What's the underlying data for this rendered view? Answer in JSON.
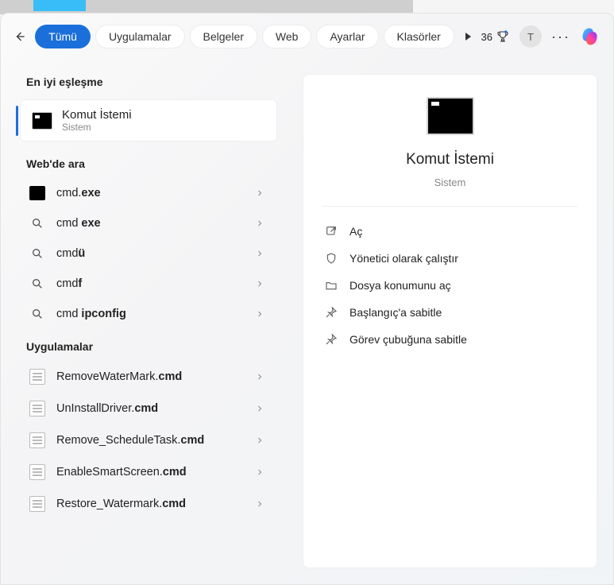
{
  "header": {
    "tabs": [
      {
        "id": "all",
        "label": "Tümü",
        "active": true
      },
      {
        "id": "apps",
        "label": "Uygulamalar",
        "active": false
      },
      {
        "id": "docs",
        "label": "Belgeler",
        "active": false
      },
      {
        "id": "web",
        "label": "Web",
        "active": false
      },
      {
        "id": "settings",
        "label": "Ayarlar",
        "active": false
      },
      {
        "id": "folders",
        "label": "Klasörler",
        "active": false
      }
    ],
    "points_value": "36",
    "avatar_initial": "T"
  },
  "left": {
    "section_best_match": "En iyi eşleşme",
    "best_match": {
      "title": "Komut İstemi",
      "subtitle": "Sistem"
    },
    "section_web": "Web'de ara",
    "web_rows": [
      {
        "icon": "black-rect",
        "html": "cmd.<b>exe</b>"
      },
      {
        "icon": "search",
        "html": "cmd <b>exe</b>"
      },
      {
        "icon": "search",
        "html": "cmd<b>ü</b>"
      },
      {
        "icon": "search",
        "html": "cmd<b>f</b>"
      },
      {
        "icon": "search",
        "html": "cmd <b>ipconfig</b>"
      }
    ],
    "section_apps": "Uygulamalar",
    "app_rows": [
      {
        "html": "RemoveWaterMark.<b>cmd</b>"
      },
      {
        "html": "UnInstallDriver.<b>cmd</b>"
      },
      {
        "html": "Remove_ScheduleTask.<b>cmd</b>"
      },
      {
        "html": "EnableSmartScreen.<b>cmd</b>"
      },
      {
        "html": "Restore_Watermark.<b>cmd</b>"
      }
    ]
  },
  "detail": {
    "title": "Komut İstemi",
    "subtitle": "Sistem",
    "actions": [
      {
        "id": "open",
        "icon": "open",
        "label": "Aç"
      },
      {
        "id": "admin",
        "icon": "shield",
        "label": "Yönetici olarak çalıştır"
      },
      {
        "id": "location",
        "icon": "folder",
        "label": "Dosya konumunu aç"
      },
      {
        "id": "pin-start",
        "icon": "pin",
        "label": "Başlangıç'a sabitle"
      },
      {
        "id": "pin-task",
        "icon": "pin",
        "label": "Görev çubuğuna sabitle"
      }
    ]
  }
}
